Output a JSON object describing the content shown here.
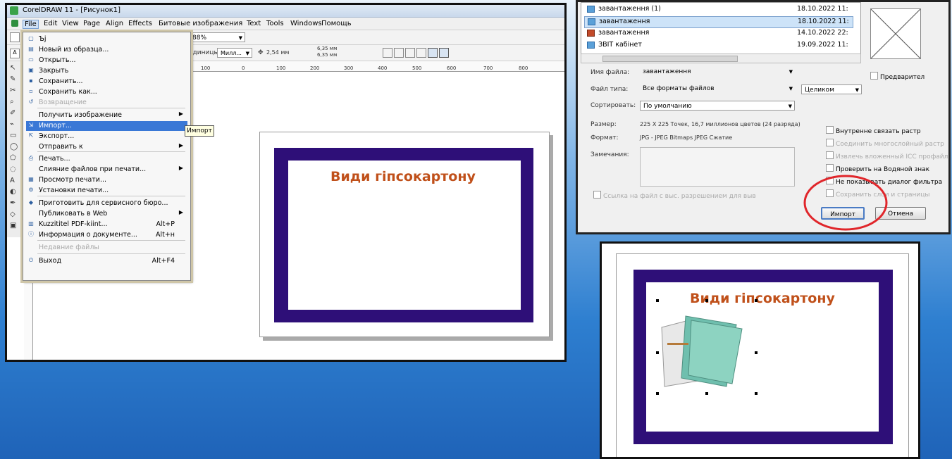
{
  "app": {
    "title": "CorelDRAW 11 - [Рисунок1]",
    "menu": [
      "File",
      "Edit",
      "View",
      "Page",
      "Align",
      "Effects",
      "Битовые изображения",
      "Text",
      "Tools",
      "Windows",
      "Помощь"
    ],
    "zoom": "88%",
    "units_label": "единицы:",
    "units_value": "Милл...",
    "nudge": "2,54 мм",
    "dup_x": "6,35 мм",
    "dup_y": "6,35 мм",
    "ruler_ticks": [
      "100",
      "0",
      "100",
      "200",
      "300",
      "400",
      "500",
      "600",
      "700",
      "800"
    ]
  },
  "file_menu": {
    "items": [
      {
        "icon": "new-icon",
        "label": "Ъj",
        "shortcut": "",
        "arrow": false,
        "disabled": false,
        "selected": false
      },
      {
        "icon": "template-icon",
        "label": "Новый из образца...",
        "shortcut": "",
        "arrow": false,
        "disabled": false,
        "selected": false
      },
      {
        "icon": "open-icon",
        "label": "Открыть...",
        "shortcut": "",
        "arrow": false,
        "disabled": false,
        "selected": false
      },
      {
        "icon": "close-icon",
        "label": "Закрыть",
        "shortcut": "",
        "arrow": false,
        "disabled": false,
        "selected": false
      },
      {
        "icon": "save-icon",
        "label": "Сохранить...",
        "shortcut": "",
        "arrow": false,
        "disabled": false,
        "selected": false
      },
      {
        "icon": "save-as-icon",
        "label": "Сохранить как...",
        "shortcut": "",
        "arrow": false,
        "disabled": false,
        "selected": false
      },
      {
        "icon": "revert-icon",
        "label": "Возвращение",
        "shortcut": "",
        "arrow": false,
        "disabled": true,
        "selected": false
      },
      {
        "icon": "",
        "label": "Получить изображение",
        "shortcut": "",
        "arrow": true,
        "disabled": false,
        "selected": false
      },
      {
        "icon": "import-icon",
        "label": "Импорт...",
        "shortcut": "",
        "arrow": false,
        "disabled": false,
        "selected": true
      },
      {
        "icon": "export-icon",
        "label": "Экспорт...",
        "shortcut": "",
        "arrow": false,
        "disabled": false,
        "selected": false
      },
      {
        "icon": "",
        "label": "Отправить к",
        "shortcut": "",
        "arrow": true,
        "disabled": false,
        "selected": false
      },
      {
        "icon": "print-icon",
        "label": "Печать...",
        "shortcut": "",
        "arrow": false,
        "disabled": false,
        "selected": false
      },
      {
        "icon": "",
        "label": "Слияние файлов при печати...",
        "shortcut": "",
        "arrow": true,
        "disabled": false,
        "selected": false
      },
      {
        "icon": "print-preview-icon",
        "label": "Просмотр печати...",
        "shortcut": "",
        "arrow": false,
        "disabled": false,
        "selected": false
      },
      {
        "icon": "print-setup-icon",
        "label": "Установки печати...",
        "shortcut": "",
        "arrow": false,
        "disabled": false,
        "selected": false
      },
      {
        "icon": "prepare-icon",
        "label": "Приготовить для сервисного бюро...",
        "shortcut": "",
        "arrow": false,
        "disabled": false,
        "selected": false
      },
      {
        "icon": "",
        "label": "Публиковать в Web",
        "shortcut": "",
        "arrow": true,
        "disabled": false,
        "selected": false
      },
      {
        "icon": "pdf-icon",
        "label": "Kuzzititel PDF-kiint...",
        "shortcut": "Alt+P",
        "arrow": false,
        "disabled": false,
        "selected": false
      },
      {
        "icon": "info-icon",
        "label": "Информация о документе...",
        "shortcut": "Alt+н",
        "arrow": false,
        "disabled": false,
        "selected": false
      },
      {
        "icon": "",
        "label": "Недавние файлы",
        "shortcut": "",
        "arrow": false,
        "disabled": true,
        "selected": false
      },
      {
        "icon": "exit-icon",
        "label": "Выход",
        "shortcut": "Alt+F4",
        "arrow": false,
        "disabled": false,
        "selected": false
      }
    ],
    "tooltip": "Импорт"
  },
  "page_title": "Види гіпсокартону",
  "dialog": {
    "files": [
      {
        "name": "завантаження (1)",
        "date": "18.10.2022 11:",
        "selected": false
      },
      {
        "name": "завантаження",
        "date": "18.10.2022 11:",
        "selected": true
      },
      {
        "name": "завантаження",
        "date": "14.10.2022 22:",
        "selected": false
      },
      {
        "name": "ЗВІТ кабінет",
        "date": "19.09.2022 11:",
        "selected": false
      }
    ],
    "filename_label": "Имя файла:",
    "filename_value": "завантаження",
    "filetype_label": "Файл типа:",
    "filetype_value": "Все форматы файлов",
    "filetype_mode": "Целиком",
    "sort_label": "Сортировать:",
    "sort_value": "По умолчанию",
    "size_label": "Размер:",
    "size_value": "225 X 225 Точек, 16,7 миллионов цветов (24 разряда)",
    "format_label": "Формат:",
    "format_value": "JPG - JPEG Bitmaps JPEG Сжатие",
    "notes_label": "Замечания:",
    "preview_label": "Предварител",
    "link_label": "Ссылка на файл с выс. разрешением для выв",
    "options": [
      {
        "label": "Внутренне связать растр",
        "disabled": false
      },
      {
        "label": "Соединить многослойный растр",
        "disabled": true
      },
      {
        "label": "Извлечь вложенный ICC профайл",
        "disabled": true
      },
      {
        "label": "Проверить на Водяной знак",
        "disabled": false
      },
      {
        "label": "Не показывать диалог фильтра",
        "disabled": false
      },
      {
        "label": "Сохранить слои и страницы",
        "disabled": true
      }
    ],
    "import_button": "Импорт",
    "cancel_button": "Отмена",
    "highlight_color": "#e0262b"
  },
  "colors": {
    "frame": "#2e0f78",
    "title": "#c0501a",
    "selection": "#3a78d6"
  }
}
